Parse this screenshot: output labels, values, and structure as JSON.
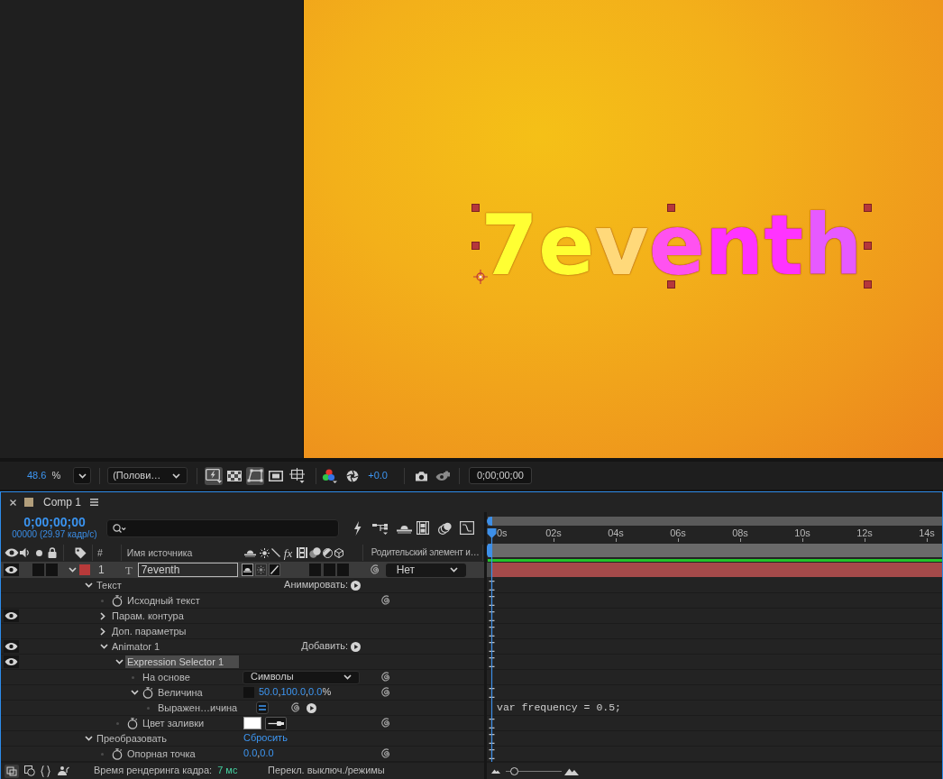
{
  "viewer": {
    "text_layer": {
      "text": "7eventh",
      "letters": [
        {
          "color": "#ffff33"
        },
        {
          "color": "#ffff33"
        },
        {
          "color": "#ffd97a"
        },
        {
          "color": "#ff52f0"
        },
        {
          "color": "#ff33ff"
        },
        {
          "color": "#ff33ff"
        },
        {
          "color": "#e65aff"
        }
      ],
      "selected": true
    },
    "toolbar": {
      "zoom": "48.6",
      "zoom_unit": "%",
      "resolution": "(Полови…",
      "toggles": [
        {
          "kind": "fast-previews",
          "selected": true
        },
        {
          "kind": "transparency-grid",
          "selected": false
        },
        {
          "kind": "mask-path",
          "selected": true
        },
        {
          "kind": "region-of-interest",
          "selected": false
        },
        {
          "kind": "grid-guides",
          "selected": false
        }
      ],
      "exposure": "+0.0",
      "timecode": "0;00;00;00"
    }
  },
  "timeline": {
    "tab": {
      "title": "Comp 1"
    },
    "current_time": "0;00;00;00",
    "frame_info": "00000 (29.97 кадр/с)",
    "columns": {
      "number": "#",
      "source_name": "Имя источника",
      "effects": "fx",
      "parent": "Родительский элемент и…"
    },
    "layer": {
      "visible": true,
      "expanded": true,
      "number": "1",
      "type_glyph": "T",
      "name": "7eventh",
      "parent": "Нет"
    },
    "properties": [
      {
        "kind": "group",
        "label": "Текст",
        "expanded": true,
        "eye": false,
        "selected": false,
        "marker": true,
        "action": "Анимировать:",
        "children": [
          {
            "kind": "source-text",
            "label": "Исходный текст",
            "eye": false,
            "selected": false,
            "marker": true
          },
          {
            "kind": "group",
            "label": "Парам. контура",
            "expanded": false,
            "eye": true,
            "selected": false,
            "marker": true
          },
          {
            "kind": "group",
            "label": "Доп. параметры",
            "expanded": false,
            "eye": false,
            "selected": false,
            "marker": true
          },
          {
            "kind": "group",
            "label": "Animator 1",
            "expanded": true,
            "eye": true,
            "selected": false,
            "marker": true,
            "action": "Добавить:",
            "children": [
              {
                "kind": "group",
                "label": "Expression Selector 1",
                "expanded": true,
                "eye": true,
                "selected": true,
                "marker": true,
                "children": [
                  {
                    "kind": "dropdown",
                    "label": "На основе",
                    "value": "Символы",
                    "eye": false,
                    "selected": false,
                    "marker": false
                  },
                  {
                    "kind": "value",
                    "label": "Величина",
                    "expanded": true,
                    "linked": false,
                    "value": "50.0,100.0,0.0%",
                    "eye": false,
                    "selected": false,
                    "marker": true,
                    "children": [
                      {
                        "kind": "expression",
                        "label": "Выражен…ичина",
                        "enabled": true,
                        "expression": "var frequency = 0.5;",
                        "eye": false,
                        "selected": false,
                        "marker": false
                      }
                    ]
                  }
                ]
              },
              {
                "kind": "color",
                "label": "Цвет заливки",
                "color": "#ffffff",
                "eye": false,
                "selected": false,
                "marker": true
              }
            ]
          }
        ]
      },
      {
        "kind": "group",
        "label": "Преобразовать",
        "expanded": true,
        "eye": false,
        "selected": false,
        "marker": true,
        "link": "Сбросить",
        "children": [
          {
            "kind": "value",
            "label": "Опорная точка",
            "value": "0.0,0.0",
            "eye": false,
            "selected": false,
            "marker": true
          }
        ]
      }
    ],
    "ruler": [
      "0s",
      "02s",
      "04s",
      "06s",
      "08s",
      "10s",
      "12s",
      "14s"
    ],
    "status_bar": {
      "render_label": "Время рендеринга кадра:",
      "render_time": "7 мс",
      "switches_label": "Перекл. выключ./режимы",
      "zoom_slider": {
        "level": 0.1
      }
    }
  }
}
